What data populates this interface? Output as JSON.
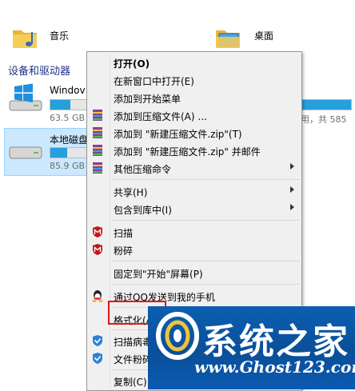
{
  "folders": [
    {
      "label": "音乐",
      "icon": "music-folder-icon"
    },
    {
      "label": "桌面",
      "icon": "desktop-folder-icon"
    }
  ],
  "section_header": "设备和驱动器",
  "drives": [
    {
      "name": "Windov",
      "size_text": "63.5 GB",
      "fill": 0.55,
      "right_text": "用，共 585"
    },
    {
      "name": "本地磁盘",
      "size_text": "85.9 GB",
      "fill": 0.45,
      "right_text": ""
    }
  ],
  "context_menu": {
    "items": [
      {
        "label": "打开(O)",
        "bold": true,
        "icon": ""
      },
      {
        "label": "在新窗口中打开(E)",
        "icon": ""
      },
      {
        "label": "添加到开始菜单",
        "icon": ""
      },
      {
        "label": "添加到压缩文件(A) ...",
        "icon": "winrar-icon"
      },
      {
        "label": "添加到 \"新建压缩文件.zip\"(T)",
        "icon": "winrar-icon"
      },
      {
        "label": "添加到 \"新建压缩文件.zip\" 并邮件",
        "icon": "winrar-icon"
      },
      {
        "label": "其他压缩命令",
        "icon": "winrar-icon",
        "submenu": true
      },
      {
        "label": "共享(H)",
        "submenu": true,
        "icon": ""
      },
      {
        "label": "包含到库中(I)",
        "submenu": true,
        "icon": ""
      },
      {
        "label": "扫描",
        "icon": "mcafee-shield-icon"
      },
      {
        "label": "粉碎",
        "icon": "mcafee-shield-icon"
      },
      {
        "label": "固定到\"开始\"屏幕(P)",
        "icon": ""
      },
      {
        "label": "通过QQ发送到我的手机",
        "icon": "qq-penguin-icon"
      },
      {
        "label": "格式化(A)...",
        "icon": ""
      },
      {
        "label": "扫描病毒",
        "icon": "security-shield-icon"
      },
      {
        "label": "文件粉碎",
        "icon": "security-shield-icon"
      },
      {
        "label": "复制(C)",
        "icon": ""
      }
    ]
  },
  "watermark": {
    "title": "系统之家",
    "url": "www.Ghost123.com"
  },
  "colors": {
    "menu_bg": "#f0f0f0",
    "highlight_border": "#e01818",
    "drive_bar_fill": "#26a0da",
    "watermark_bg": "#0a4f99"
  }
}
